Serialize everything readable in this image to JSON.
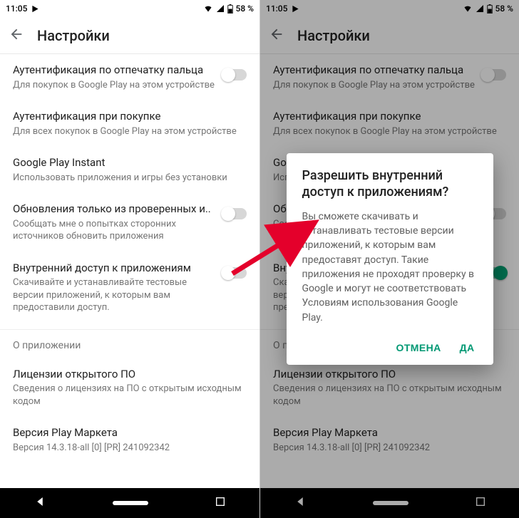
{
  "statusbar": {
    "time": "11:05",
    "battery_text": "58 %"
  },
  "header": {
    "title": "Настройки"
  },
  "items": {
    "fingerprint": {
      "title": "Аутентификация по отпечатку пальца",
      "sub": "Для покупок в Google Play на этом устройстве"
    },
    "purchase_auth": {
      "title": "Аутентификация при покупке",
      "sub": "Для всех покупок в Google Play на этом устройстве"
    },
    "instant": {
      "title": "Google Play Instant",
      "sub": "Использовать приложения и игры без установки"
    },
    "verified_updates": {
      "title": "Обновления только из проверенных и..",
      "sub": "Сообщать мне о попытках сторонних источников обновить приложения"
    },
    "internal_access": {
      "title": "Внутренний доступ к приложениям",
      "sub": "Скачивайте и устанавливайте тестовые версии приложений, к которым вам предоставили доступ."
    }
  },
  "about_section": "О приложении",
  "licenses": {
    "title": "Лицензии открытого ПО",
    "sub": "Сведения о лицензиях на ПО с открытым исходным кодом"
  },
  "version": {
    "title": "Версия Play Маркета",
    "sub": "Версия 14.3.18-all [0] [PR] 241092342"
  },
  "dialog": {
    "title": "Разрешить внутренний доступ к приложениям?",
    "body": "Вы сможете скачивать и устанавливать тестовые версии приложений, к которым вам предоставят доступ. Такие приложения не проходят проверку в Google и могут не соответствовать Условиям использования Google Play.",
    "cancel": "ОТМЕНА",
    "ok": "ДА"
  },
  "right_truncated": {
    "instant_title": "Goo",
    "instant_sub": "Исп",
    "verified_title": "Обн",
    "verified_sub_l1": "Соо",
    "verified_sub_l2": "исто",
    "internal_title": "Вну",
    "internal_sub_l1": "Скач",
    "internal_sub_l2": "верси",
    "internal_sub_l3": "предо"
  }
}
